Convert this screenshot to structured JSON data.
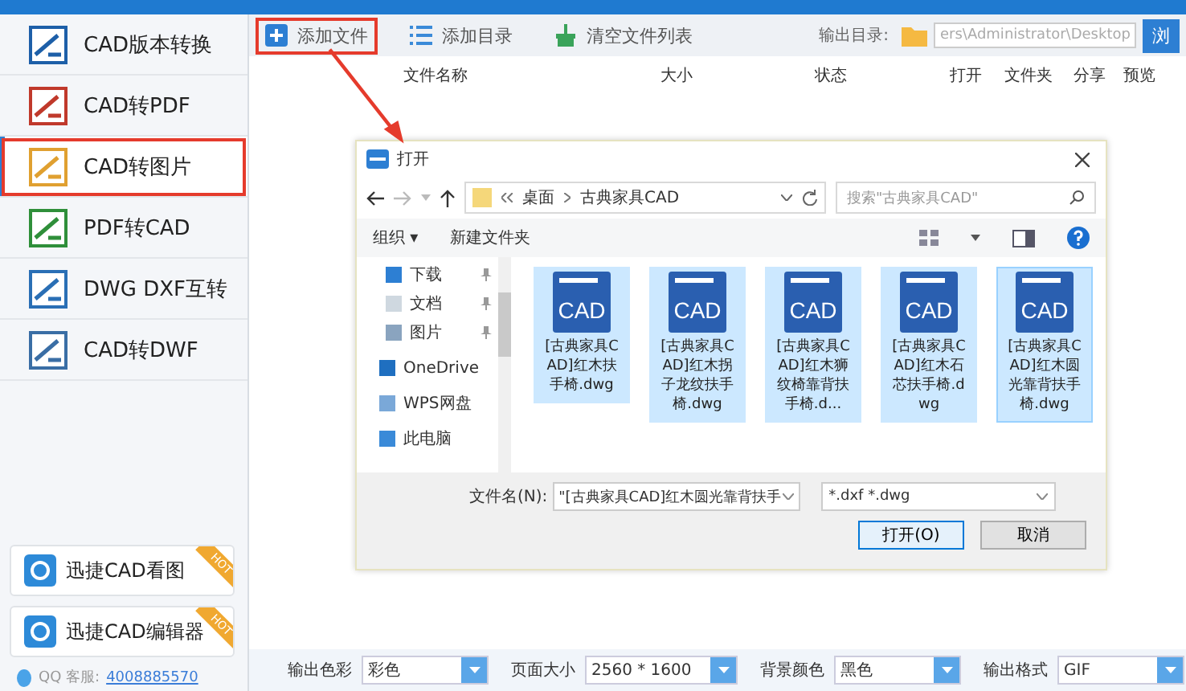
{
  "sidebar": {
    "items": [
      {
        "label": "CAD版本转换",
        "selected": false
      },
      {
        "label": "CAD转PDF",
        "selected": false
      },
      {
        "label": "CAD转图片",
        "selected": true
      },
      {
        "label": "PDF转CAD",
        "selected": false
      },
      {
        "label": "DWG DXF互转",
        "selected": false
      },
      {
        "label": "CAD转DWF",
        "selected": false
      }
    ],
    "promos": [
      {
        "label": "迅捷CAD看图",
        "badge": "HOT"
      },
      {
        "label": "迅捷CAD编辑器",
        "badge": "HOT"
      }
    ],
    "support": {
      "label": "QQ 客服:",
      "phone": "4008885570"
    }
  },
  "toolbar": {
    "buttons": [
      {
        "label": "添加文件",
        "highlighted": true
      },
      {
        "label": "添加目录",
        "highlighted": false
      },
      {
        "label": "清空文件列表",
        "highlighted": false
      }
    ],
    "output_label": "输出目录:",
    "output_path": "ers\\Administrator\\Desktop",
    "browse": "浏"
  },
  "columns": [
    "文件名称",
    "大小",
    "状态",
    "打开",
    "文件夹",
    "分享",
    "预览"
  ],
  "dialog": {
    "title": "打开",
    "path": [
      "桌面",
      "古典家具CAD"
    ],
    "search_placeholder": "搜索\"古典家具CAD\"",
    "organize": "组织 ▾",
    "new_folder": "新建文件夹",
    "nav": [
      {
        "label": "下载",
        "pinned": true
      },
      {
        "label": "文档",
        "pinned": true
      },
      {
        "label": "图片",
        "pinned": true
      },
      {
        "label": "OneDrive",
        "pinned": false
      },
      {
        "label": "WPS网盘",
        "pinned": false
      },
      {
        "label": "此电脑",
        "pinned": false
      }
    ],
    "files": [
      {
        "icon_label": "CAD",
        "name": "[古典家具CAD]红木扶手椅.dwg",
        "selected": true,
        "focused": false
      },
      {
        "icon_label": "CAD",
        "name": "[古典家具CAD]红木拐子龙纹扶手椅.dwg",
        "selected": true,
        "focused": false
      },
      {
        "icon_label": "CAD",
        "name": "[古典家具CAD]红木狮纹椅靠背扶手椅.d...",
        "selected": true,
        "focused": false
      },
      {
        "icon_label": "CAD",
        "name": "[古典家具CAD]红木石芯扶手椅.dwg",
        "selected": true,
        "focused": false
      },
      {
        "icon_label": "CAD",
        "name": "[古典家具CAD]红木圆光靠背扶手椅.dwg",
        "selected": true,
        "focused": true
      }
    ],
    "filename_label": "文件名(N):",
    "filename_value": "\"[古典家具CAD]红木圆光靠背扶手",
    "filter": "*.dxf *.dwg",
    "open_button": "打开(O)",
    "cancel_button": "取消"
  },
  "settings": [
    {
      "label": "输出色彩",
      "value": "彩色"
    },
    {
      "label": "页面大小",
      "value": "2560 * 1600"
    },
    {
      "label": "背景颜色",
      "value": "黑色"
    },
    {
      "label": "输出格式",
      "value": "GIF"
    }
  ]
}
